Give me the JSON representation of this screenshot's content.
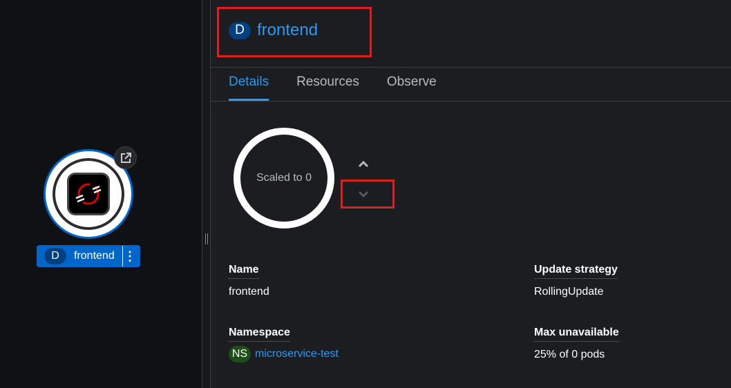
{
  "topology_node": {
    "kind_badge": "D",
    "name": "frontend",
    "colors": {
      "ring": "#0066cc",
      "label_bg": "#0066cc",
      "icon_accent": "#e00000"
    }
  },
  "panel": {
    "header": {
      "kind_badge": "D",
      "title": "frontend"
    },
    "tabs": [
      {
        "label": "Details",
        "active": true
      },
      {
        "label": "Resources",
        "active": false
      },
      {
        "label": "Observe",
        "active": false
      }
    ],
    "pod_ring": {
      "status_text": "Scaled to 0"
    },
    "details": {
      "name_label": "Name",
      "name_value": "frontend",
      "namespace_label": "Namespace",
      "namespace_badge": "NS",
      "namespace_value": "microservice-test",
      "update_strategy_label": "Update strategy",
      "update_strategy_value": "RollingUpdate",
      "max_unavailable_label": "Max unavailable",
      "max_unavailable_value": "25% of 0 pods"
    },
    "accent_color": "#2b9af3",
    "highlight_color": "#e01e1e"
  }
}
